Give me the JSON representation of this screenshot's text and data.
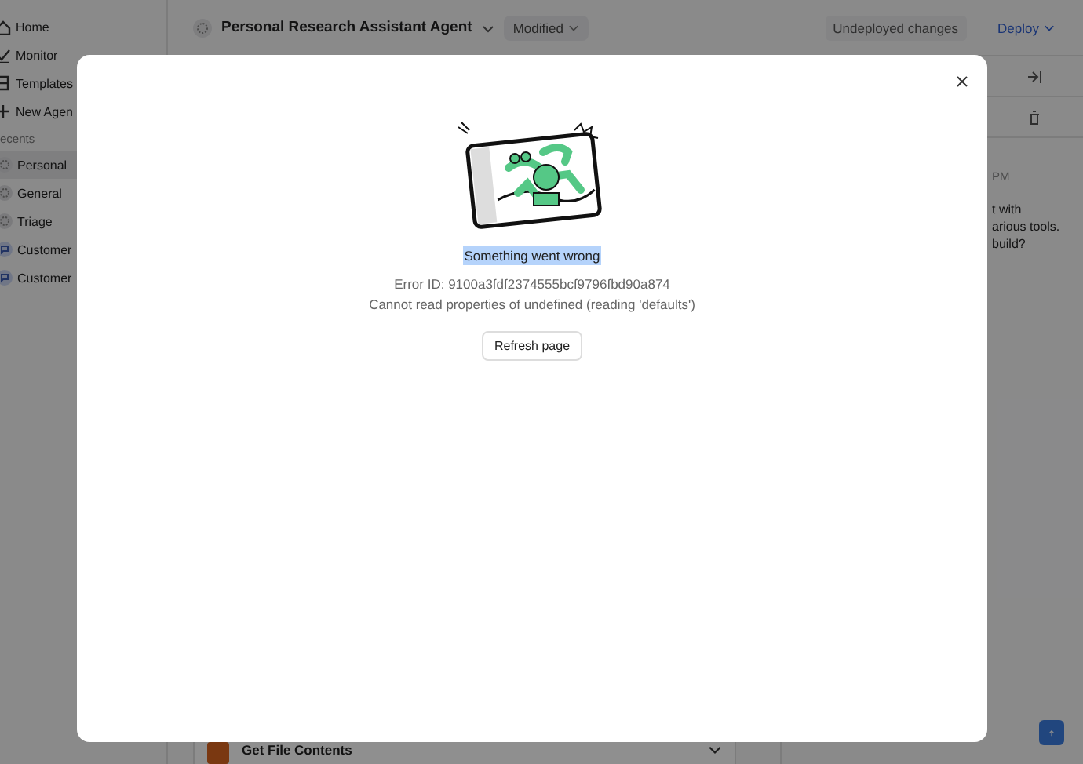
{
  "sidebar": {
    "nav": [
      {
        "label": "Home"
      },
      {
        "label": "Monitor"
      },
      {
        "label": "Templates"
      },
      {
        "label": "New Agen"
      }
    ],
    "recents_label": "ecents",
    "recents": [
      {
        "label": "Personal",
        "kind": "agent",
        "selected": true
      },
      {
        "label": "General",
        "kind": "agent",
        "selected": false
      },
      {
        "label": "Triage",
        "kind": "agent",
        "selected": false
      },
      {
        "label": "Customer",
        "kind": "chat",
        "selected": false
      },
      {
        "label": "Customer",
        "kind": "chat",
        "selected": false
      }
    ]
  },
  "header": {
    "title": "Personal Research Assistant Agent",
    "status": "Modified",
    "changes": "Undeployed changes",
    "deploy": "Deploy"
  },
  "chat": {
    "time": "PM",
    "lines": [
      "t with",
      "arious tools.",
      "build?"
    ]
  },
  "tool_card": {
    "title": "Get File Contents"
  },
  "dialog": {
    "title": "Something went wrong",
    "title_highlighted": true,
    "error_id": "Error ID: 9100a3fdf2374555bcf9796fbd90a874",
    "message": "Cannot read properties of undefined (reading 'defaults')",
    "button": "Refresh page"
  }
}
